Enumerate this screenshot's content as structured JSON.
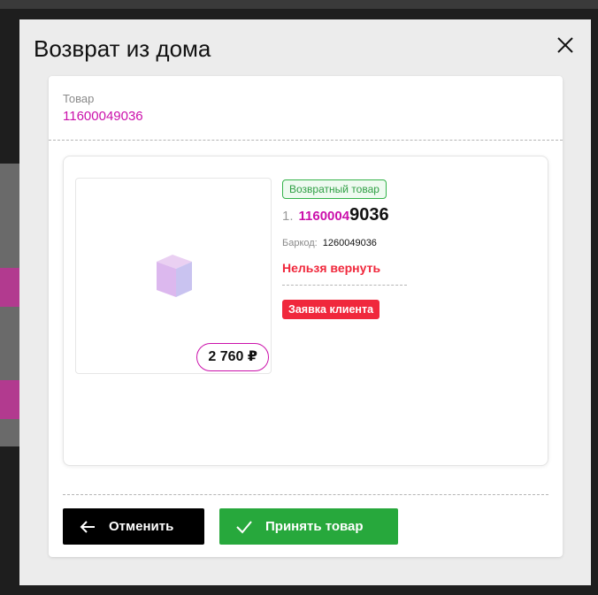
{
  "modal": {
    "title": "Возврат из дома",
    "close_icon": "close-icon"
  },
  "goods": {
    "label": "Товар",
    "value": "11600049036"
  },
  "item": {
    "status_badge": "Возвратный товар",
    "index": "1.",
    "number_prefix": "1160004",
    "number_suffix": "9036",
    "barcode_label": "Баркод:",
    "barcode_value": "1260049036",
    "warning": "Нельзя вернуть",
    "request_badge": "Заявка клиента",
    "price": "2 760 ₽",
    "image_icon": "box-placeholder-icon"
  },
  "actions": {
    "cancel_label": "Отменить",
    "cancel_icon": "arrow-left-icon",
    "accept_label": "Принять товар",
    "accept_icon": "checkmark-icon"
  },
  "colors": {
    "accent": "#cb11ab",
    "success": "#27a83c",
    "danger": "#f0283c"
  }
}
